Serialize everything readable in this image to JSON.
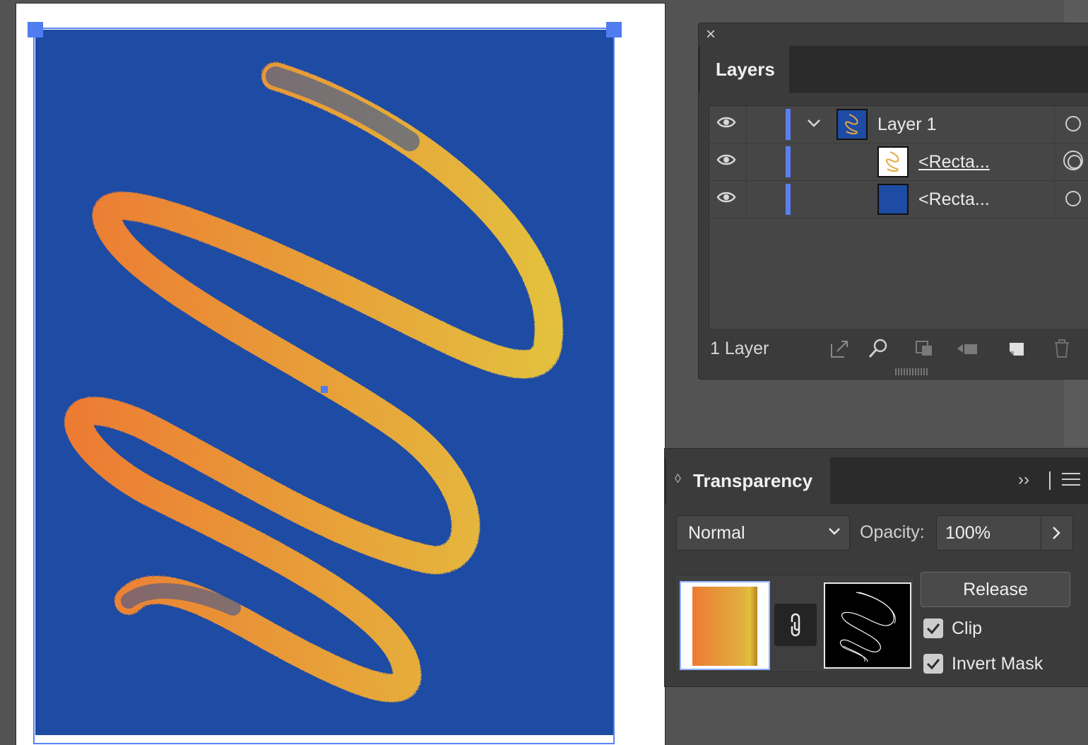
{
  "canvas": {
    "artwork_colors": {
      "background": "#1e4ba3",
      "stroke_start": "#ec7b33",
      "stroke_end": "#e3c23e",
      "selection": "#4f7cf0"
    }
  },
  "layers_panel": {
    "close_icon": "close-icon",
    "tab_label": "Layers",
    "rows": [
      {
        "name": "Layer 1",
        "expanded": true,
        "thumb": "layer-thumb",
        "target": "single"
      },
      {
        "name": "<Recta...",
        "underlined": true,
        "thumb": "swirl-thumb",
        "target": "double"
      },
      {
        "name": "<Recta...",
        "underlined": false,
        "thumb": "blue-thumb",
        "target": "single"
      }
    ],
    "footer": {
      "count": "1 Layer",
      "icons": [
        "export-icon",
        "search-icon",
        "clip-icon",
        "move-icon",
        "new-layer-icon",
        "trash-icon"
      ]
    }
  },
  "transparency_panel": {
    "tab_label": "Transparency",
    "blend_mode": "Normal",
    "opacity_label": "Opacity:",
    "opacity_value": "100%",
    "release_label": "Release",
    "clip_label": "Clip",
    "clip_checked": true,
    "invert_label": "Invert Mask",
    "invert_checked": true
  }
}
